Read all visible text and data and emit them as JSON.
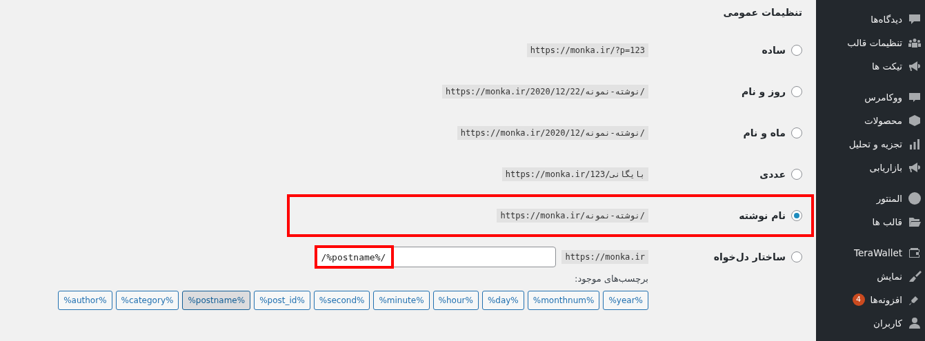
{
  "heading": "تنظیمات عمومی",
  "options": [
    {
      "label": "ساده",
      "sample": "https://monka.ir/?p=123",
      "selected": false,
      "highlighted": false
    },
    {
      "label": "روز و نام",
      "sample": "https://monka.ir/2020/12/22/نوشته-نمونه/",
      "selected": false,
      "highlighted": false
    },
    {
      "label": "ماه و نام",
      "sample": "https://monka.ir/2020/12/نوشته-نمونه/",
      "selected": false,
      "highlighted": false
    },
    {
      "label": "عددی",
      "sample": "https://monka.ir/123/بایگانی",
      "selected": false,
      "highlighted": false
    },
    {
      "label": "نام نوشته",
      "sample": "https://monka.ir/نوشته-نمونه/",
      "selected": true,
      "highlighted": true
    }
  ],
  "custom": {
    "label": "ساختار دل‌خواه",
    "selected": false,
    "prefix": "https://monka.ir",
    "value": "/%postname%/",
    "value_highlighted": true,
    "tags_label": "برچسب‌های موجود:",
    "tags": [
      {
        "label": "%year%",
        "selected": false
      },
      {
        "label": "%monthnum%",
        "selected": false
      },
      {
        "label": "%day%",
        "selected": false
      },
      {
        "label": "%hour%",
        "selected": false
      },
      {
        "label": "%minute%",
        "selected": false
      },
      {
        "label": "%second%",
        "selected": false
      },
      {
        "label": "%post_id%",
        "selected": false
      },
      {
        "label": "%postname%",
        "selected": true
      },
      {
        "label": "%category%",
        "selected": false
      },
      {
        "label": "%author%",
        "selected": false
      }
    ]
  },
  "sidebar": {
    "groups": [
      {
        "items": [
          {
            "label": "دیدگاه‌ها"
          },
          {
            "label": "تنظیمات قالب"
          },
          {
            "label": "تیکت ها"
          }
        ]
      },
      {
        "items": [
          {
            "label": "ووکامرس"
          },
          {
            "label": "محصولات"
          },
          {
            "label": "تجزیه و تحلیل"
          },
          {
            "label": "بازاریابی"
          }
        ]
      },
      {
        "items": [
          {
            "label": "المنتور"
          },
          {
            "label": "قالب ها"
          }
        ]
      },
      {
        "items": [
          {
            "label": "TeraWallet"
          },
          {
            "label": "نمایش"
          },
          {
            "label": "افزونه‌ها",
            "badge": "4"
          },
          {
            "label": "کاربران"
          }
        ]
      }
    ]
  }
}
